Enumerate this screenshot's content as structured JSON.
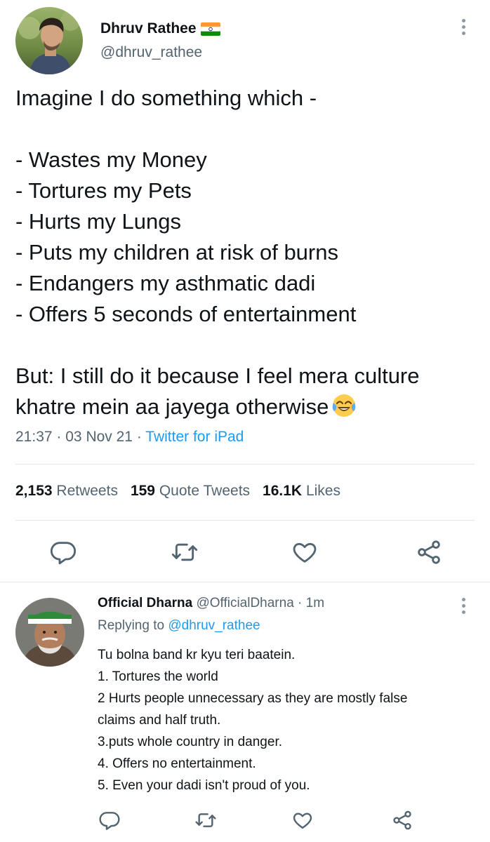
{
  "tweet": {
    "author_name": "Dhruv Rathee",
    "author_handle": "@dhruv_rathee",
    "text_lines": [
      "Imagine I do something which -",
      "",
      "- Wastes my Money",
      "- Tortures my Pets",
      "- Hurts my Lungs",
      "- Puts my children at risk of burns",
      "- Endangers my asthmatic dadi",
      "- Offers 5 seconds of entertainment",
      "",
      "But: I still do it because I feel mera culture",
      "khatre mein aa jayega otherwise"
    ],
    "emoji": "face-with-tears-of-joy",
    "time": "21:37",
    "date": "03 Nov 21",
    "separator": "·",
    "client": "Twitter for iPad",
    "stats": {
      "retweets_count": "2,153",
      "retweets_label": "Retweets",
      "quotes_count": "159",
      "quotes_label": "Quote Tweets",
      "likes_count": "16.1K",
      "likes_label": "Likes"
    }
  },
  "reply": {
    "author_name": "Official Dharna",
    "author_handle": "@OfficialDharna",
    "separator": "·",
    "age": "1m",
    "replying_to_label": "Replying to",
    "replying_to_handle": "@dhruv_rathee",
    "text_lines": [
      "Tu bolna band kr kyu teri baatein.",
      "1. Tortures the world",
      "2 Hurts people unnecessary as they are mostly false",
      "claims and half truth.",
      "3.puts whole country in danger.",
      "4. Offers no entertainment.",
      "5. Even your dadi isn't proud of you."
    ]
  },
  "icons": {
    "reply": "reply-icon",
    "retweet": "retweet-icon",
    "like": "heart-icon",
    "share": "share-icon",
    "more": "more-vertical-icon",
    "flag": "india-flag-icon"
  },
  "colors": {
    "text": "#0f1419",
    "secondary": "#536471",
    "accent": "#1d9bf0",
    "divider": "#e1e6ea"
  }
}
